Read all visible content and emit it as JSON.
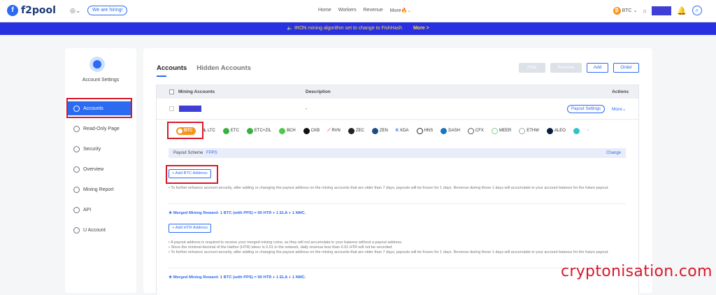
{
  "header": {
    "brand": "f2pool",
    "hiring": "We are hiring!",
    "nav": [
      "Home",
      "Workers",
      "Revenue",
      "More"
    ],
    "coin": "BTC"
  },
  "banner": {
    "text": "IRON mining algorithm set to change to FishHash",
    "more": "More >"
  },
  "sidebar": {
    "title": "Account Settings",
    "items": [
      {
        "label": "Accounts"
      },
      {
        "label": "Read-Only Page"
      },
      {
        "label": "Security"
      },
      {
        "label": "Overview"
      },
      {
        "label": "Mining Report"
      },
      {
        "label": "API"
      },
      {
        "label": "U Account"
      }
    ]
  },
  "main": {
    "tabs": [
      "Accounts",
      "Hidden Accounts"
    ],
    "buttons": {
      "hide": "Hide",
      "remove": "Remove",
      "add": "Add",
      "order": "Order"
    },
    "table": {
      "col_accounts": "Mining Accounts",
      "col_description": "Description",
      "col_actions": "Actions",
      "description_value": "-",
      "payout_settings": "Payout Settings",
      "more": "More"
    },
    "coins": [
      "BTC",
      "LTC",
      "ETC",
      "ETC+ZIL",
      "BCH",
      "CKB",
      "RVN",
      "ZEC",
      "ZEN",
      "KDA",
      "HNS",
      "DASH",
      "CFX",
      "MEER",
      "ETHW",
      "ALEO"
    ],
    "scheme": {
      "label": "Payout Scheme",
      "value": "FPPS",
      "change": "Change"
    },
    "add_btc": "+ Add BTC Address",
    "note1": "• To further enhance account security, after adding or changing the payout address on the mining accounts that are older than 7 days, payouts will be frozen for 1 days. Revenue during those 1 days will accumulate in your account balance for the future payout.",
    "merged": "Merged Mining Reward: 1 BTC (with PPS) = 90 HTR + 1 ELA + 1 NMC.",
    "add_htr": "+ Add HTR Address",
    "note2a": "• A payout address is required to receive your merged mining coins, as they will not accumulate in your balance without a payout address.",
    "note2b": "• Since the minimal decimal of the Hathor (HTR) token is 0.01 in the network, daily revenue less than 0.01 HTR will not be recorded.",
    "note2c": "• To further enhance account security, after adding or changing the payout address on the mining accounts that are older than 7 days, payouts will be frozen for 1 days. Revenue during those 1 days will accumulate in your account balance for the future payout."
  },
  "watermark": "cryptonisation.com"
}
